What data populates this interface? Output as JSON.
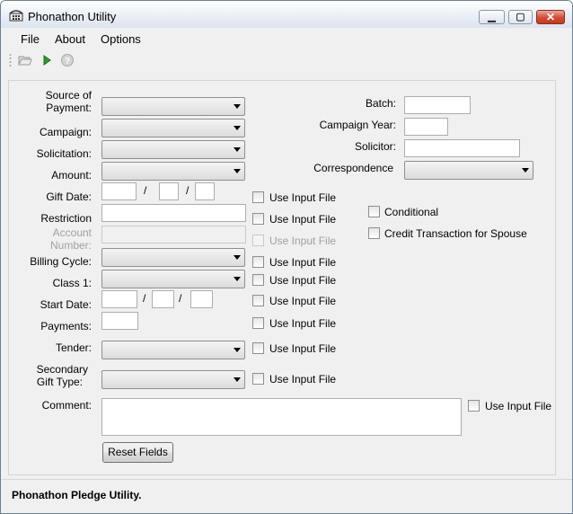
{
  "window": {
    "title": "Phonathon Utility",
    "min_glyph": "▁",
    "max_glyph": "▢",
    "close_glyph": "✕"
  },
  "menu": [
    {
      "label": "File"
    },
    {
      "label": "About"
    },
    {
      "label": "Options"
    }
  ],
  "toolbar": {
    "icons": [
      "open-folder-icon",
      "run-icon",
      "help-icon"
    ]
  },
  "form": {
    "source_of_payment_label_1": "Source of",
    "source_of_payment_label_2": "Payment:",
    "campaign_label": "Campaign:",
    "solicitation_label": "Solicitation:",
    "amount_label": "Amount:",
    "gift_date_label": "Gift Date:",
    "restriction_label": "Restriction",
    "account_number_label_1": "Account",
    "account_number_label_2": "Number:",
    "billing_cycle_label": "Billing Cycle:",
    "class1_label": "Class 1:",
    "start_date_label": "Start Date:",
    "payments_label": "Payments:",
    "tender_label": "Tender:",
    "secondary_gift_type_label_1": "Secondary",
    "secondary_gift_type_label_2": "Gift Type:",
    "comment_label": "Comment:",
    "batch_label": "Batch:",
    "campaign_year_label": "Campaign Year:",
    "solicitor_label": "Solicitor:",
    "correspondence_label": "Correspondence",
    "date_separator": "/",
    "use_input_file": "Use Input File",
    "conditional": "Conditional",
    "credit_transaction_spouse": "Credit Transaction for Spouse",
    "reset_button": "Reset Fields"
  },
  "status": {
    "text": "Phonathon Pledge Utility."
  }
}
